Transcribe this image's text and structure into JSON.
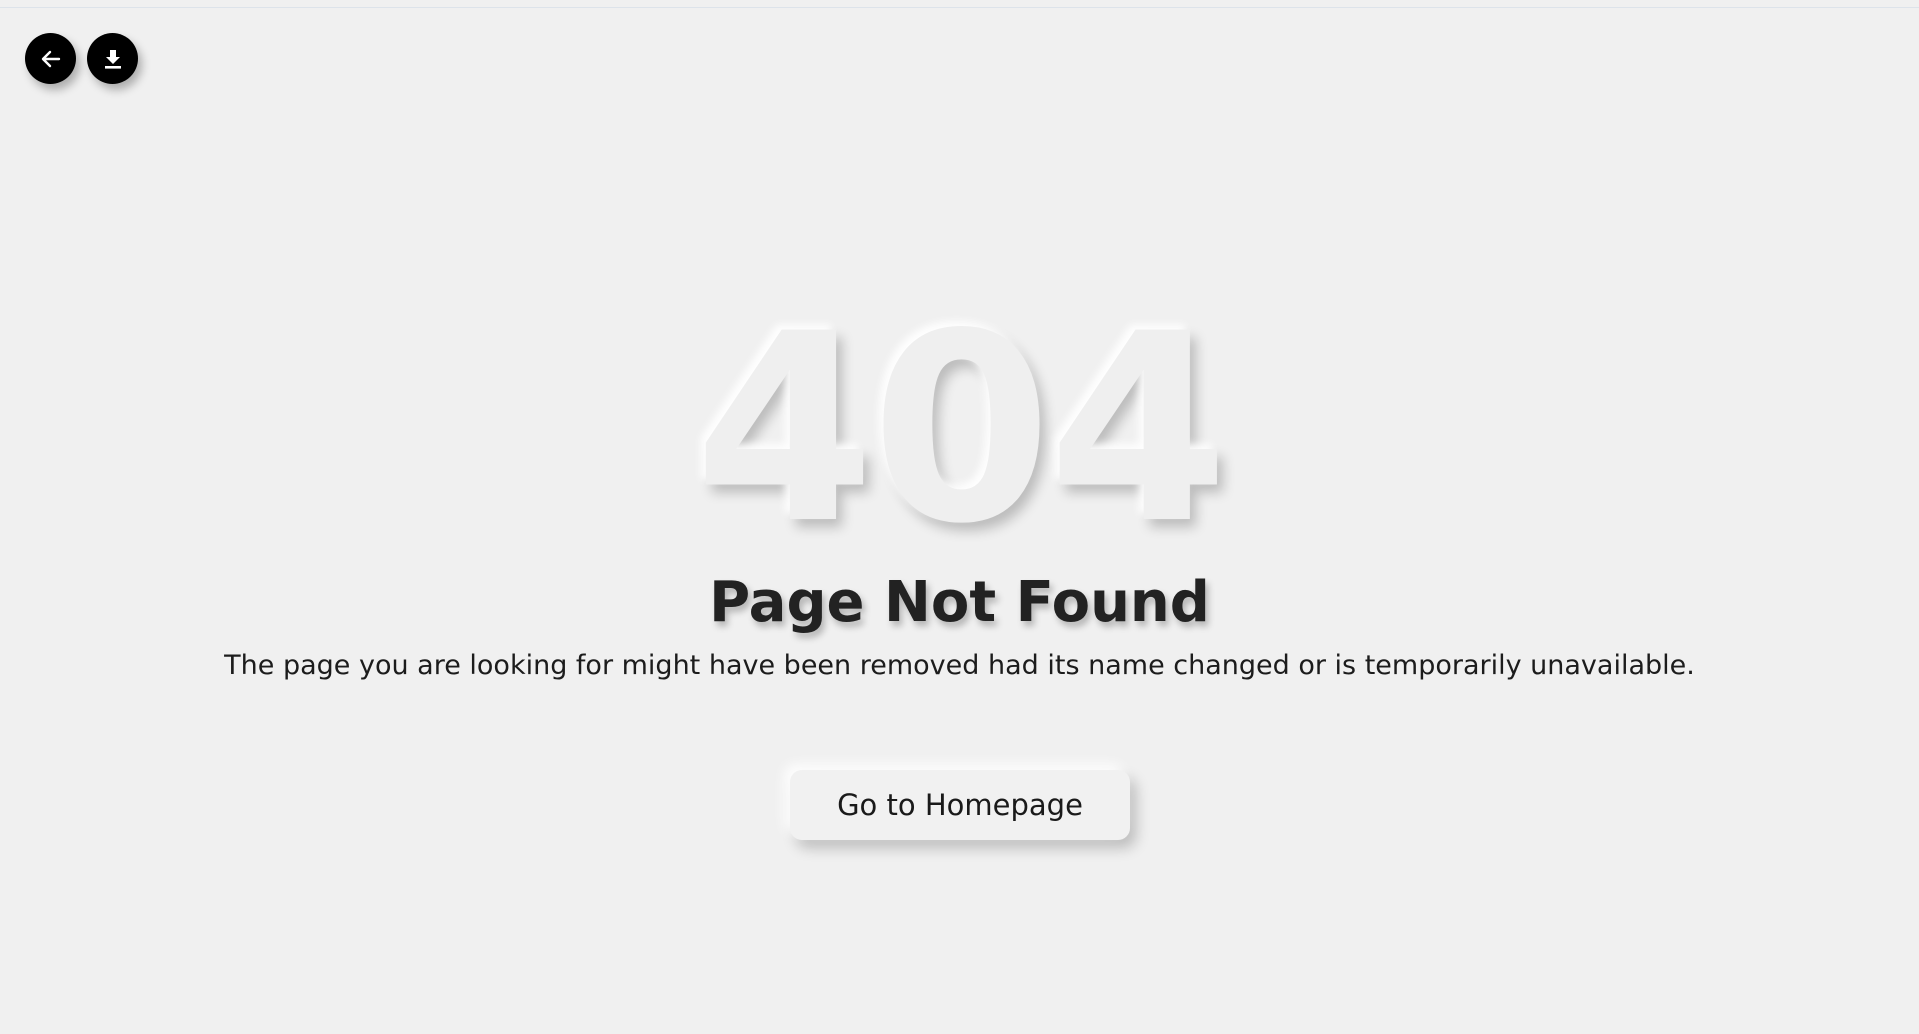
{
  "top_bar": {
    "back_icon": "arrow-left-icon",
    "download_icon": "download-icon"
  },
  "main": {
    "error_code": "404",
    "title": "Page Not Found",
    "message": "The page you are looking for might have been removed had its name changed or is temporarily unavailable.",
    "home_button_label": "Go to Homepage"
  },
  "colors": {
    "background": "#f0f0f0",
    "icon_button": "#000000",
    "text": "#222222"
  }
}
